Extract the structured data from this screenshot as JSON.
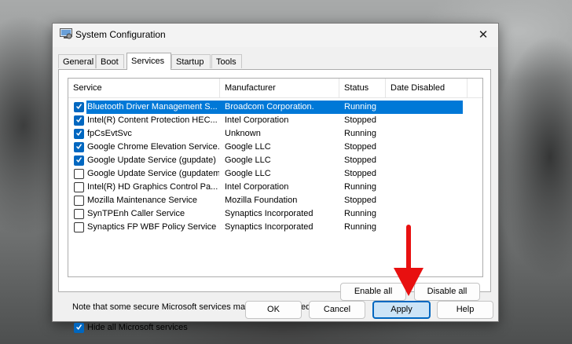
{
  "window": {
    "title": "System Configuration",
    "close_glyph": "✕"
  },
  "tabs": [
    {
      "label": "General"
    },
    {
      "label": "Boot"
    },
    {
      "label": "Services",
      "active": true
    },
    {
      "label": "Startup"
    },
    {
      "label": "Tools"
    }
  ],
  "columns": [
    "Service",
    "Manufacturer",
    "Status",
    "Date Disabled"
  ],
  "services": [
    {
      "checked": true,
      "name": "Bluetooth Driver Management S...",
      "manufacturer": "Broadcom Corporation.",
      "status": "Running",
      "date_disabled": "",
      "selected": true
    },
    {
      "checked": true,
      "name": "Intel(R) Content Protection HEC...",
      "manufacturer": "Intel Corporation",
      "status": "Stopped",
      "date_disabled": ""
    },
    {
      "checked": true,
      "name": "fpCsEvtSvc",
      "manufacturer": "Unknown",
      "status": "Running",
      "date_disabled": ""
    },
    {
      "checked": true,
      "name": "Google Chrome Elevation Service...",
      "manufacturer": "Google LLC",
      "status": "Stopped",
      "date_disabled": ""
    },
    {
      "checked": true,
      "name": "Google Update Service (gupdate)",
      "manufacturer": "Google LLC",
      "status": "Stopped",
      "date_disabled": ""
    },
    {
      "checked": false,
      "name": "Google Update Service (gupdatem)",
      "manufacturer": "Google LLC",
      "status": "Stopped",
      "date_disabled": ""
    },
    {
      "checked": false,
      "name": "Intel(R) HD Graphics Control Pa...",
      "manufacturer": "Intel Corporation",
      "status": "Running",
      "date_disabled": ""
    },
    {
      "checked": false,
      "name": "Mozilla Maintenance Service",
      "manufacturer": "Mozilla Foundation",
      "status": "Stopped",
      "date_disabled": ""
    },
    {
      "checked": false,
      "name": "SynTPEnh Caller Service",
      "manufacturer": "Synaptics Incorporated",
      "status": "Running",
      "date_disabled": ""
    },
    {
      "checked": false,
      "name": "Synaptics FP WBF Policy Service",
      "manufacturer": "Synaptics Incorporated",
      "status": "Running",
      "date_disabled": ""
    }
  ],
  "note": "Note that some secure Microsoft services may not be disabled.",
  "buttons": {
    "enable_all": "Enable all",
    "disable_all": "Disable all",
    "ok": "OK",
    "cancel": "Cancel",
    "apply": "Apply",
    "help": "Help"
  },
  "hide_microsoft": {
    "label": "Hide all Microsoft services",
    "checked": true
  },
  "colors": {
    "selection": "#0078d7",
    "checkbox": "#0067c0",
    "annotation_arrow": "#e81010"
  }
}
